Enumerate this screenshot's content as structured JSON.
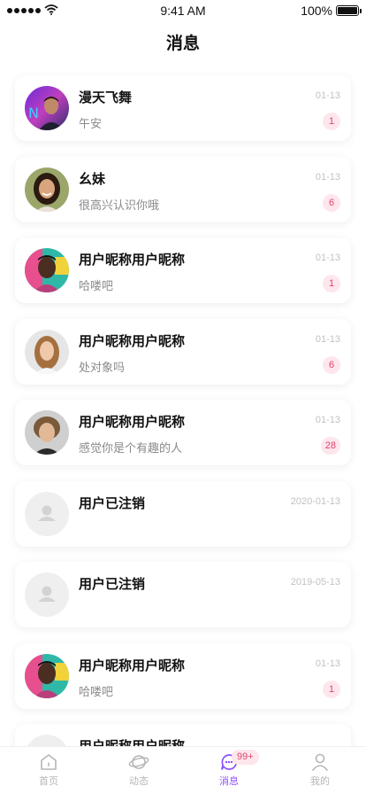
{
  "status_bar": {
    "time": "9:41 AM",
    "battery": "100%"
  },
  "header": {
    "title": "消息"
  },
  "conversations": [
    {
      "name": "漫天飞舞",
      "message": "午安",
      "date": "01-13",
      "unread": "1",
      "avatar": "avatar-man-neon"
    },
    {
      "name": "幺妹",
      "message": "很高兴认识你哦",
      "date": "01-13",
      "unread": "6",
      "avatar": "avatar-woman-smiling"
    },
    {
      "name": "用户昵称用户昵称",
      "message": "哈喽吧",
      "date": "01-13",
      "unread": "1",
      "avatar": "avatar-man-colorful"
    },
    {
      "name": "用户昵称用户昵称",
      "message": "处对象吗",
      "date": "01-13",
      "unread": "6",
      "avatar": "avatar-woman-blonde"
    },
    {
      "name": "用户昵称用户昵称",
      "message": "感觉你是个有趣的人",
      "date": "01-13",
      "unread": "28",
      "avatar": "avatar-man-curly"
    },
    {
      "name": "用户已注销",
      "message": "",
      "date": "2020-01-13",
      "unread": "",
      "avatar": "avatar-placeholder"
    },
    {
      "name": "用户已注销",
      "message": "",
      "date": "2019-05-13",
      "unread": "",
      "avatar": "avatar-placeholder"
    },
    {
      "name": "用户昵称用户昵称",
      "message": "哈喽吧",
      "date": "01-13",
      "unread": "1",
      "avatar": "avatar-man-colorful"
    },
    {
      "name": "用户昵称用户昵称",
      "message": "",
      "date": "",
      "unread": "",
      "avatar": "avatar-placeholder"
    }
  ],
  "tab_bar": {
    "tabs": [
      {
        "label": "首页",
        "icon": "home-icon"
      },
      {
        "label": "动态",
        "icon": "planet-icon"
      },
      {
        "label": "消息",
        "icon": "message-icon"
      },
      {
        "label": "我的",
        "icon": "profile-icon"
      }
    ],
    "message_badge": "99+"
  },
  "colors": {
    "accent": "#8c52ff",
    "badge_text": "#e0466f",
    "badge_bg": "#fde6ec"
  }
}
